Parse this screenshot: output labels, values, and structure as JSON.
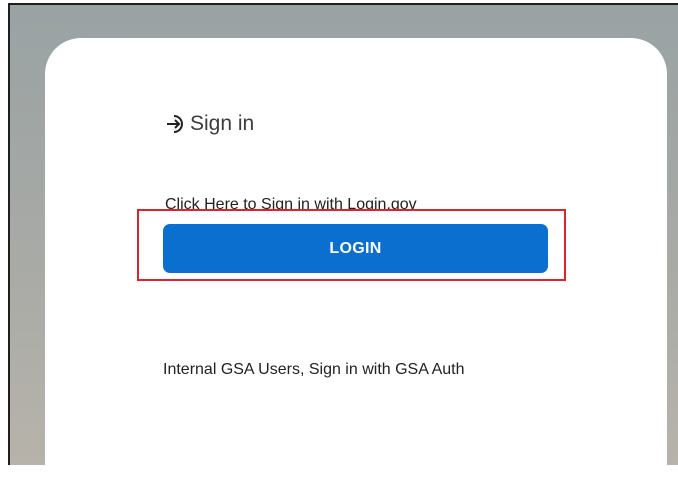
{
  "signin": {
    "heading": "Sign in",
    "icon": "sign-in-arrow-icon"
  },
  "login_gov": {
    "caption": "Click Here to Sign in with Login.gov",
    "button_label": "LOGIN"
  },
  "gsa_auth": {
    "text": "Internal GSA Users, Sign in with GSA Auth"
  },
  "colors": {
    "button": "#0b6fd0",
    "highlight": "#e0222c",
    "background": "#a8aaa6"
  }
}
